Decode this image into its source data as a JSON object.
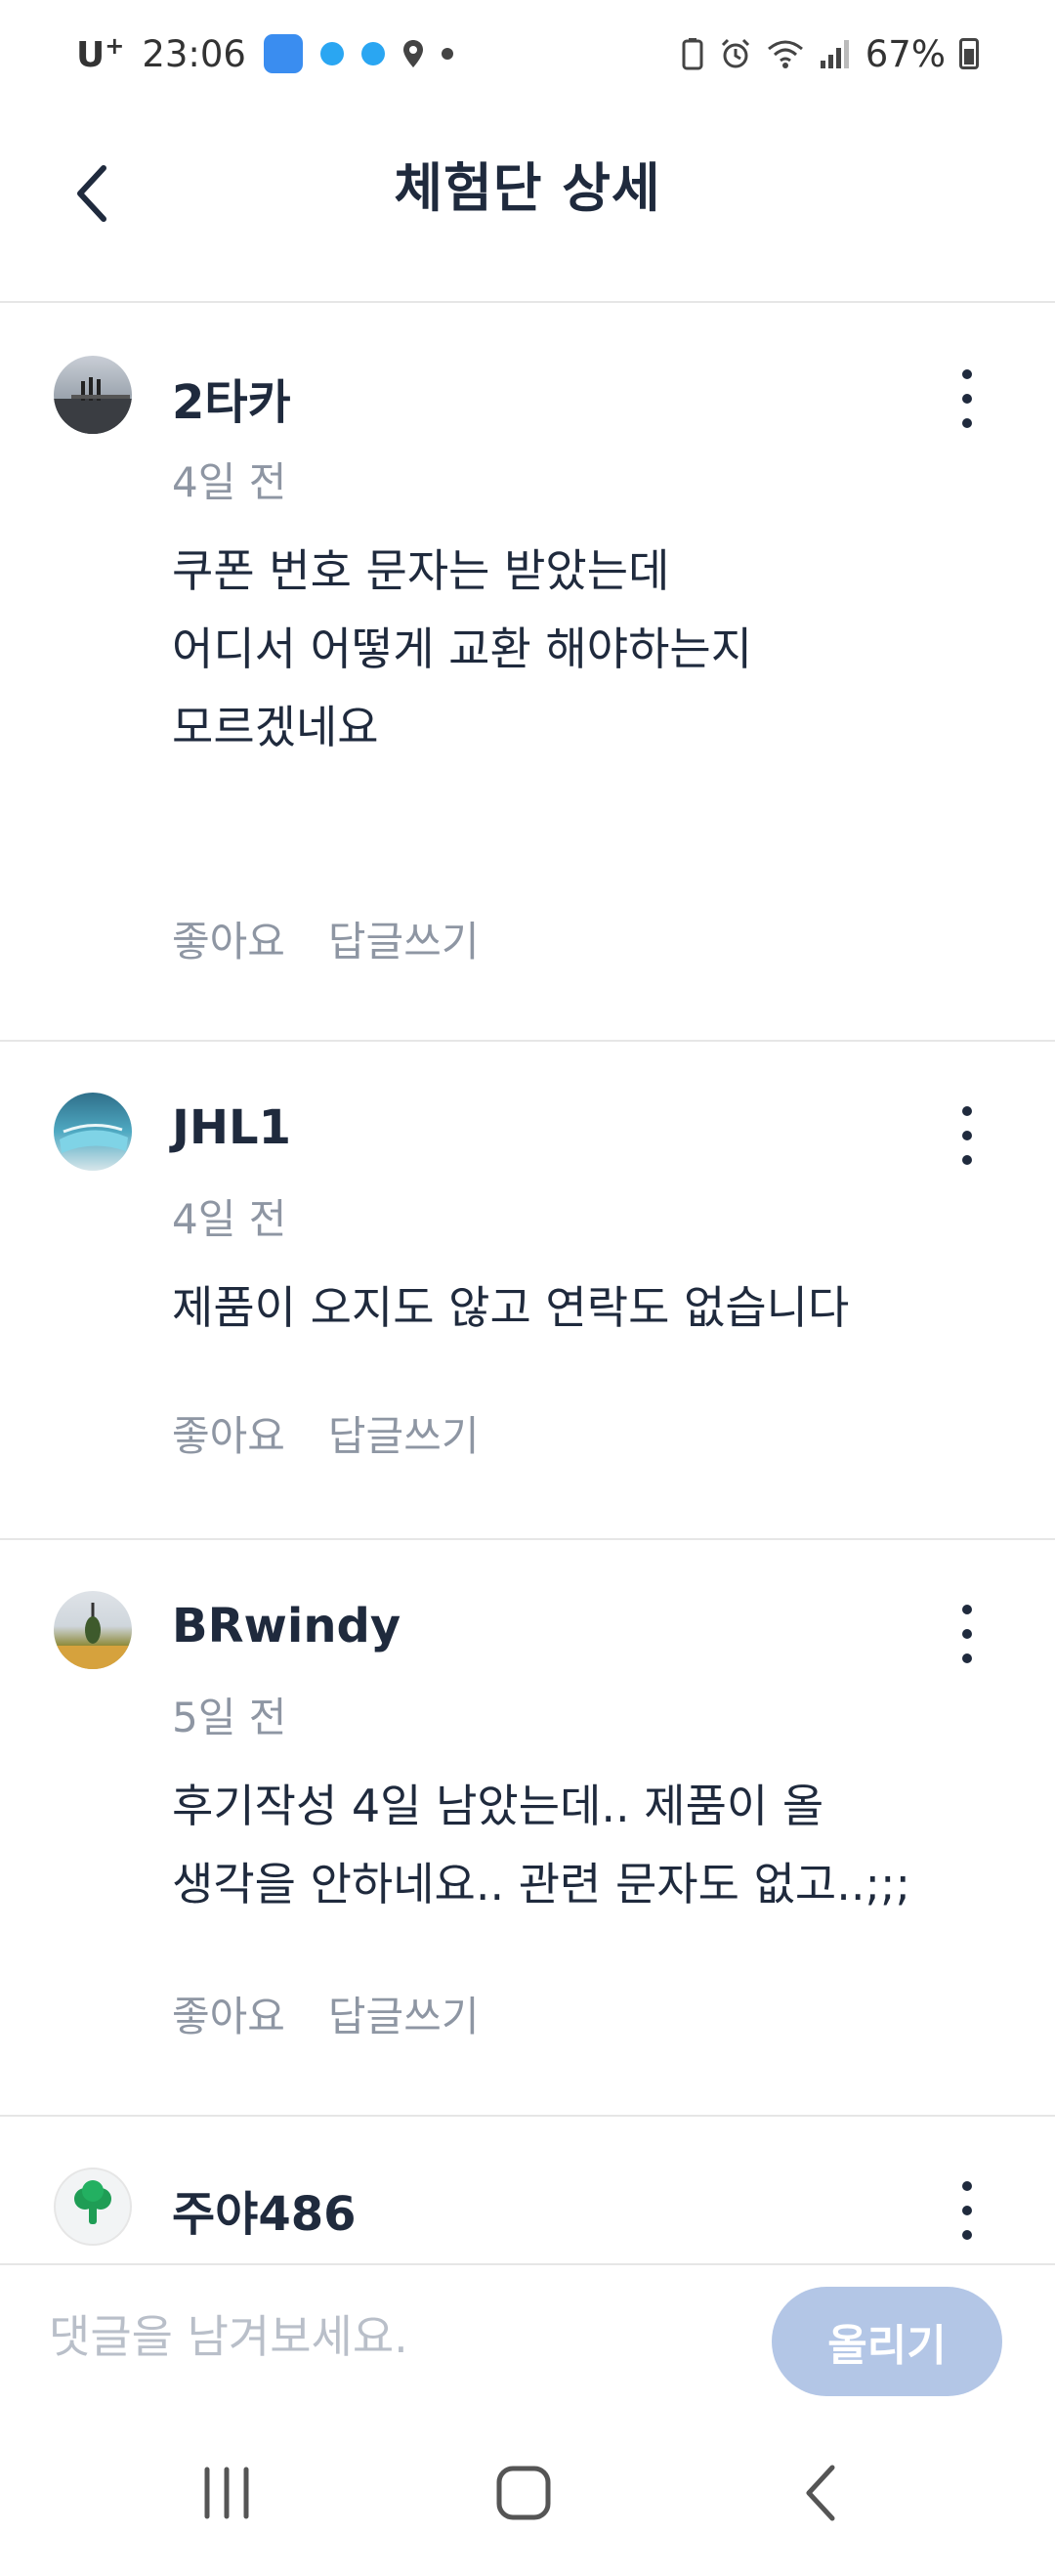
{
  "status_bar": {
    "carrier": "U",
    "carrier_sup": "+",
    "time": "23:06",
    "battery": "67%"
  },
  "header": {
    "title": "체험단 상세"
  },
  "comments": [
    {
      "username": "2타카",
      "time": "4일 전",
      "lines": [
        "쿠폰 번호 문자는 받았는데",
        "어디서 어떻게 교환 해야하는지",
        "모르겠네요"
      ],
      "like_label": "좋아요",
      "reply_label": "답글쓰기"
    },
    {
      "username": "JHL1",
      "time": "4일 전",
      "lines": [
        "제품이 오지도 않고 연락도 없습니다"
      ],
      "like_label": "좋아요",
      "reply_label": "답글쓰기"
    },
    {
      "username": "BRwindy",
      "time": "5일 전",
      "lines": [
        "후기작성 4일 남았는데.. 제품이 올",
        "생각을 안하네요.. 관련 문자도 없고..;;;"
      ],
      "like_label": "좋아요",
      "reply_label": "답글쓰기"
    },
    {
      "username": "주야486"
    }
  ],
  "input": {
    "placeholder": "댓글을 남겨보세요.",
    "submit_label": "올리기"
  },
  "colors": {
    "text": "#1f2a3d",
    "muted": "#8e96a3",
    "divider": "#e6e6e6",
    "button_disabled": "#b3c6e6"
  },
  "icons": {
    "back": "chevron-left-icon",
    "more": "more-vertical-icon",
    "nav_recent": "recent-apps-icon",
    "nav_home": "home-icon",
    "nav_back": "nav-back-icon"
  }
}
